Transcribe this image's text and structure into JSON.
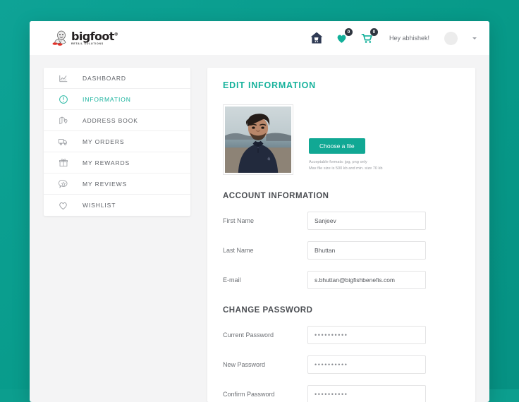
{
  "theme": {
    "background_teal": "#0a9e8e",
    "accent_teal": "#17b29c",
    "button_teal": "#11a894",
    "badge_dark": "#2f3640",
    "text_gray": "#5f6268"
  },
  "topbar": {
    "logo": {
      "word": "bigfoot",
      "trademark": "®",
      "tagline": "RETAIL SOLUTIONS",
      "mark_icon": "bigfoot-mascot-icon"
    },
    "store_icon": "home-store-icon",
    "wishlist": {
      "icon": "heart-icon",
      "badge": "0"
    },
    "cart": {
      "icon": "shopping-cart-icon",
      "badge": "0"
    },
    "greeting": "Hey abhishek!",
    "avatar_icon": "user-avatar",
    "caret_icon": "chevron-down-icon"
  },
  "sidebar": {
    "items": [
      {
        "label": "DASHBOARD",
        "icon": "chart-icon",
        "active": false
      },
      {
        "label": "INFORMATION",
        "icon": "info-circle-icon",
        "active": true
      },
      {
        "label": "ADDRESS BOOK",
        "icon": "map-pin-icon",
        "active": false
      },
      {
        "label": "MY ORDERS",
        "icon": "truck-icon",
        "active": false
      },
      {
        "label": "MY REWARDS",
        "icon": "gift-icon",
        "active": false
      },
      {
        "label": "MY REVIEWS",
        "icon": "chat-star-icon",
        "active": false
      },
      {
        "label": "WISHLIST",
        "icon": "heart-outline-icon",
        "active": false
      }
    ]
  },
  "main": {
    "page_title": "EDIT INFORMATION",
    "upload": {
      "photo_alt": "profile-photo",
      "button_label": "Choose a file",
      "hint_line_1": "Acceptable formats: jpg, png only",
      "hint_line_2": "Max file size is 500 kb and min. size 70 kb"
    },
    "account_section": {
      "title": "ACCOUNT INFORMATION",
      "fields": [
        {
          "label": "First Name",
          "value": "Sanjeev",
          "type": "text"
        },
        {
          "label": "Last Name",
          "value": "Bhuttan",
          "type": "text"
        },
        {
          "label": "E-mail",
          "value": "s.bhuttan@bigfishbenefis.com",
          "type": "email"
        }
      ]
    },
    "password_section": {
      "title": "CHANGE PASSWORD",
      "fields": [
        {
          "label": "Current Password",
          "value": "••••••••••",
          "type": "password"
        },
        {
          "label": "New Password",
          "value": "••••••••••",
          "type": "password"
        },
        {
          "label": "Confirm Password",
          "value": "••••••••••",
          "type": "password"
        }
      ]
    }
  }
}
